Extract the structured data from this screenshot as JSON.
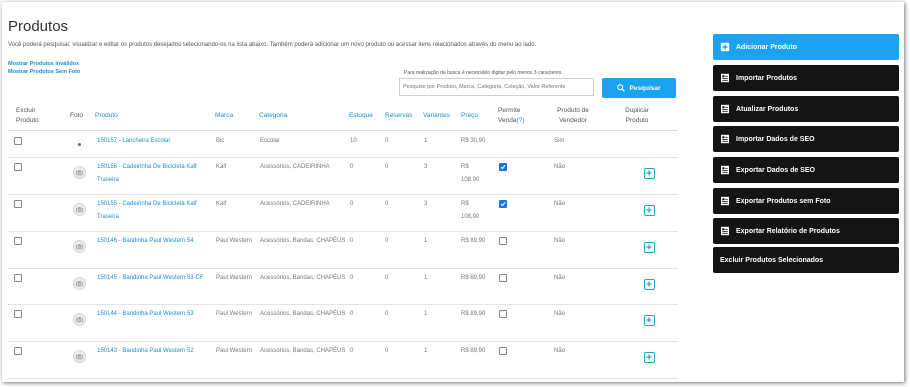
{
  "page": {
    "title": "Produtos",
    "description": "Você poderá pesquisar, visualizar e editar os produtos desejados selecionando-os na lista abaixo. Também poderá adicionar um novo produto ou acessar itens relacionados através do menu ao lado.",
    "link_invalid": "Mostrar Produtos inválidos",
    "link_no_photo": "Mostrar Produtos Sem Foto"
  },
  "search": {
    "hint": "Para realização da busca é necessário digitar pelo menos 3 caracteres.",
    "placeholder": "Pesquise por Produto, Marca, Categoria, Coleção, Valor Referente",
    "value": "",
    "button_label": "Pesquisar",
    "icon": "search-icon"
  },
  "table": {
    "headers": {
      "excluir": "Excluir Produto",
      "foto": "Foto",
      "produto": "Produto",
      "marca": "Marca",
      "categoria": "Categoria",
      "estoque": "Estoque",
      "reservas": "Reservas",
      "variantes": "Variantes",
      "preco": "Preço",
      "permite_venda": "Permite Venda",
      "permite_venda_help": "(?)",
      "produto_vendedor": "Produto de Vendedor",
      "duplicar": "Duplicar Produto"
    },
    "rows": [
      {
        "produto": "150157 - Lancheira Escolar",
        "marca": "Bic",
        "categoria": "Escolar",
        "estoque": "10",
        "reservas": "0",
        "variantes": "1",
        "preco": "R$ 30,90",
        "permite_venda": null,
        "vendedor": "Sim",
        "duplicar": false,
        "foto": "dot"
      },
      {
        "produto": "150156 - Cadeirinha De Bicicleta Kalf Traseira",
        "marca": "Kalf",
        "categoria": "Acessórios, CADEIRINHA",
        "estoque": "0",
        "reservas": "0",
        "variantes": "3",
        "preco": "R$ 108,90",
        "permite_venda": true,
        "vendedor": "Não",
        "duplicar": true,
        "foto": "camera"
      },
      {
        "produto": "150155 - Cadeirinha De Bicicleta Kalf Traseira",
        "marca": "Kalf",
        "categoria": "Acessórios, CADEIRINHA",
        "estoque": "0",
        "reservas": "0",
        "variantes": "3",
        "preco": "R$ 108,90",
        "permite_venda": true,
        "vendedor": "Não",
        "duplicar": true,
        "foto": "camera"
      },
      {
        "produto": "150146 - Bandinha Paul Western 54",
        "marca": "Paul Western",
        "categoria": "Acessórios, Bandas, CHAPÉUS",
        "estoque": "0",
        "reservas": "0",
        "variantes": "1",
        "preco": "R$ 89,90",
        "permite_venda": false,
        "vendedor": "Não",
        "duplicar": true,
        "foto": "camera"
      },
      {
        "produto": "150145 - Bandinha Paul Western 53-CF",
        "marca": "Paul Western",
        "categoria": "Acessórios, Bandas, CHAPÉUS",
        "estoque": "0",
        "reservas": "0",
        "variantes": "1",
        "preco": "R$ 89,90",
        "permite_venda": false,
        "vendedor": "Não",
        "duplicar": true,
        "foto": "camera"
      },
      {
        "produto": "150144 - Bandinha Paul Western 53",
        "marca": "Paul Western",
        "categoria": "Acessórios, Bandas, CHAPÉUS",
        "estoque": "0",
        "reservas": "0",
        "variantes": "1",
        "preco": "R$ 89,90",
        "permite_venda": false,
        "vendedor": "Não",
        "duplicar": true,
        "foto": "camera"
      },
      {
        "produto": "150143 - Bandinha Paul Western 52",
        "marca": "Paul Western",
        "categoria": "Acessórios, Bandas, CHAPÉUS",
        "estoque": "0",
        "reservas": "0",
        "variantes": "1",
        "preco": "R$ 89,90",
        "permite_venda": false,
        "vendedor": "Não",
        "duplicar": true,
        "foto": "camera"
      }
    ]
  },
  "sidebar": {
    "buttons": [
      {
        "label": "Adicionar Produto",
        "icon": "plus-square-icon",
        "style": "blue"
      },
      {
        "label": "Importar Produtos",
        "icon": "document-icon",
        "style": "dark"
      },
      {
        "label": "Atualizar Produtos",
        "icon": "document-icon",
        "style": "dark"
      },
      {
        "label": "Importar Dados de SEO",
        "icon": "document-icon",
        "style": "dark"
      },
      {
        "label": "Exportar Dados de SEO",
        "icon": "document-icon",
        "style": "dark"
      },
      {
        "label": "Exportar Produtos sem Foto",
        "icon": "document-icon",
        "style": "dark"
      },
      {
        "label": "Exportar Relatório de Produtos",
        "icon": "document-icon",
        "style": "dark"
      },
      {
        "label": "Excluir Produtos Selecionados",
        "icon": "",
        "style": "dark"
      }
    ]
  },
  "colors": {
    "accent": "#1aa3ee",
    "link": "#1a8fd0",
    "dark_button": "#141414",
    "check": "#1a73e8",
    "duplicate": "#18a6c9"
  }
}
